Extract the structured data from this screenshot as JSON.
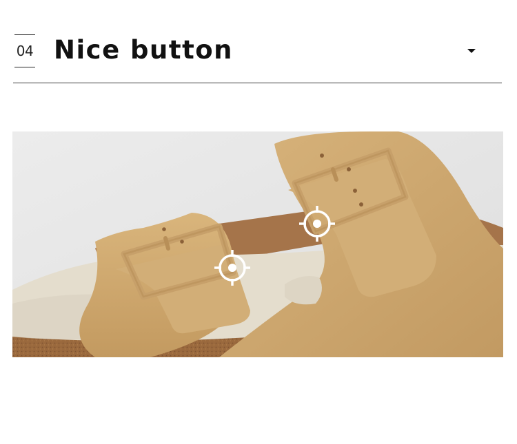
{
  "section": {
    "number": "04",
    "title": "Nice button"
  },
  "icons": {
    "toggle": "caret-down-icon",
    "markers": [
      "crosshair-icon",
      "crosshair-icon"
    ]
  },
  "colors": {
    "text": "#111111",
    "divider": "#3a3a3a",
    "suede": "#cfa870",
    "cork": "#9c6a3e",
    "footbed": "#e4ddcd",
    "background": "#e8e8e8"
  }
}
